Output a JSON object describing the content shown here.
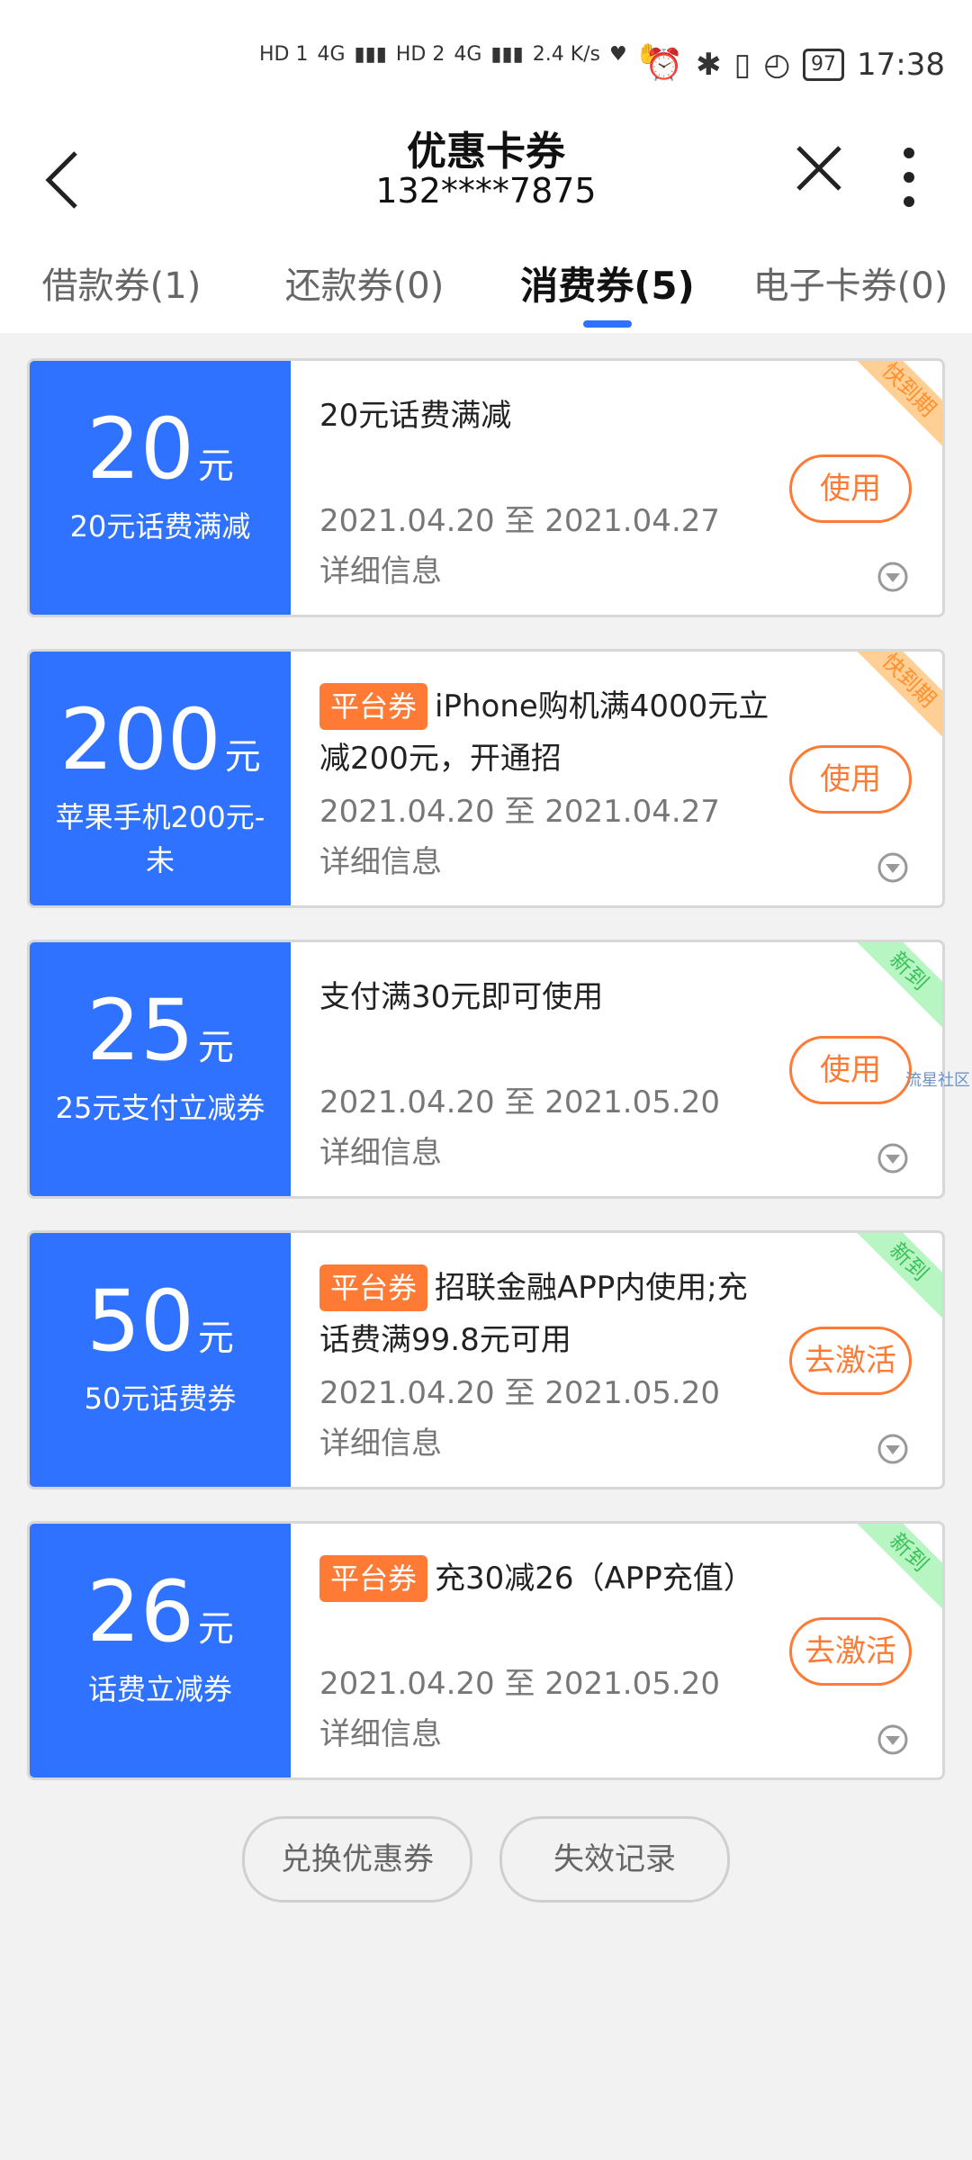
{
  "status_bar": {
    "hd1": "HD 1",
    "hd2": "HD 2",
    "net1": "4G",
    "net2": "4G",
    "speed": "2.4 K/s",
    "battery": "97",
    "time": "17:38"
  },
  "header": {
    "title": "优惠卡券",
    "subtitle": "132****7875"
  },
  "tabs": [
    {
      "label": "借款券(1)"
    },
    {
      "label": "还款券(0)"
    },
    {
      "label": "消费券(5)"
    },
    {
      "label": "电子卡券(0)"
    }
  ],
  "coupons": [
    {
      "amount": "20",
      "unit": "元",
      "name": "20元话费满减",
      "tag": "",
      "desc": "20元话费满减",
      "dates": "2021.04.20 至 2021.04.27",
      "detail": "详细信息",
      "action": "使用",
      "ribbon": "快到期"
    },
    {
      "amount": "200",
      "unit": "元",
      "name": "苹果手机200元-未",
      "tag": "平台券",
      "desc": "iPhone购机满4000元立减200元，开通招",
      "dates": "2021.04.20 至 2021.04.27",
      "detail": "详细信息",
      "action": "使用",
      "ribbon": "快到期"
    },
    {
      "amount": "25",
      "unit": "元",
      "name": "25元支付立减券",
      "tag": "",
      "desc": "支付满30元即可使用",
      "dates": "2021.04.20 至 2021.05.20",
      "detail": "详细信息",
      "action": "使用",
      "ribbon": "新到"
    },
    {
      "amount": "50",
      "unit": "元",
      "name": "50元话费券",
      "tag": "平台券",
      "desc": "招联金融APP内使用;充话费满99.8元可用",
      "dates": "2021.04.20 至 2021.05.20",
      "detail": "详细信息",
      "action": "去激活",
      "ribbon": "新到"
    },
    {
      "amount": "26",
      "unit": "元",
      "name": "话费立减券",
      "tag": "平台券",
      "desc": "充30减26（APP充值）",
      "dates": "2021.04.20 至 2021.05.20",
      "detail": "详细信息",
      "action": "去激活",
      "ribbon": "新到"
    }
  ],
  "watermark": "流星社区",
  "bottom": {
    "exchange": "兑换优惠券",
    "expired": "失效记录"
  }
}
